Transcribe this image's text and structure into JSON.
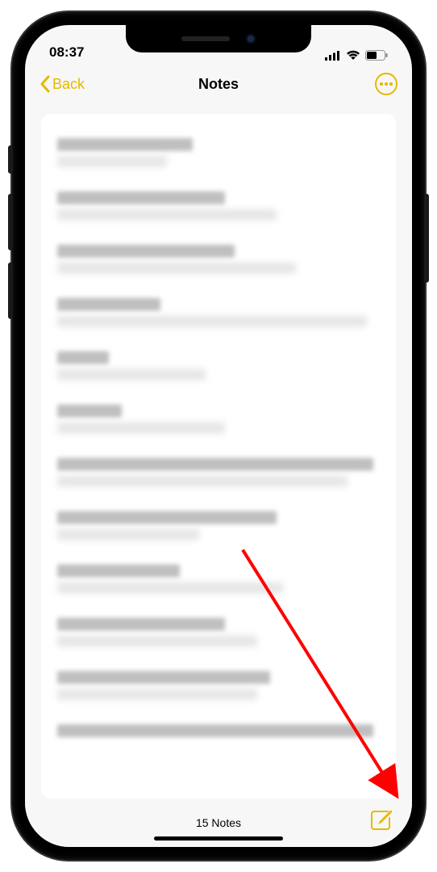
{
  "status": {
    "time": "08:37"
  },
  "nav": {
    "back_label": "Back",
    "title": "Notes"
  },
  "toolbar": {
    "count_label": "15 Notes"
  },
  "colors": {
    "accent": "#e6b800"
  },
  "notes_list": [
    {
      "title_width": "42%",
      "sub_width": "34%"
    },
    {
      "title_width": "52%",
      "sub_width": "68%"
    },
    {
      "title_width": "55%",
      "sub_width": "74%"
    },
    {
      "title_width": "32%",
      "sub_width": "96%"
    },
    {
      "title_width": "16%",
      "sub_width": "46%"
    },
    {
      "title_width": "20%",
      "sub_width": "52%"
    },
    {
      "title_width": "98%",
      "sub_width": "90%"
    },
    {
      "title_width": "68%",
      "sub_width": "44%"
    },
    {
      "title_width": "38%",
      "sub_width": "70%"
    },
    {
      "title_width": "52%",
      "sub_width": "62%"
    },
    {
      "title_width": "66%",
      "sub_width": "62%"
    },
    {
      "title_width": "98%",
      "sub_width": "0%"
    }
  ]
}
